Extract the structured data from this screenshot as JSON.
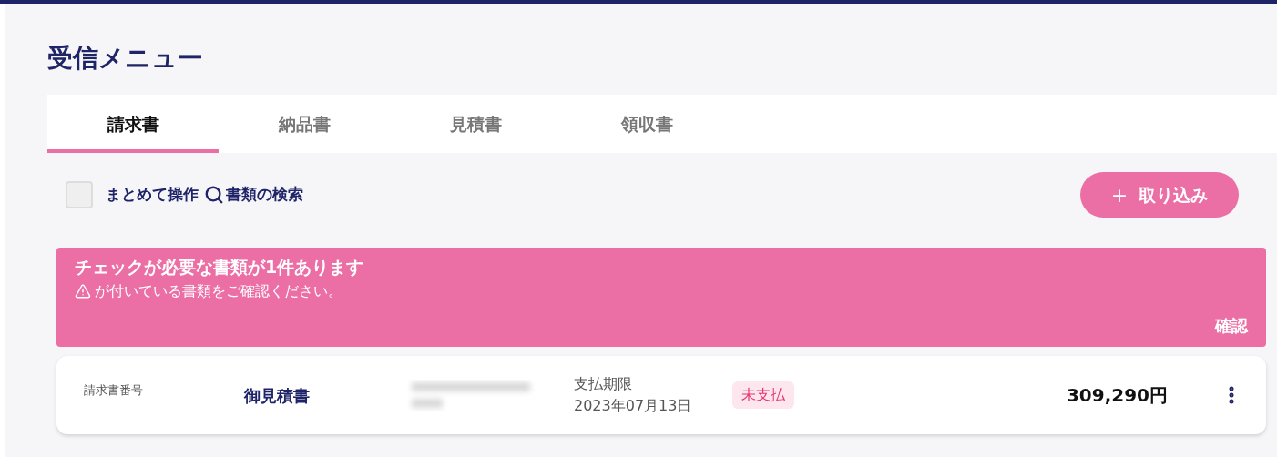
{
  "page_title": "受信メニュー",
  "tabs": [
    {
      "label": "請求書",
      "selected": true
    },
    {
      "label": "納品書",
      "selected": false
    },
    {
      "label": "見積書",
      "selected": false
    },
    {
      "label": "領収書",
      "selected": false
    }
  ],
  "toolbar": {
    "bulk_action": {
      "label": "まとめて操作",
      "checked": false
    },
    "search_link": "書類の検索",
    "import_button": {
      "icon": "+",
      "label": "取り込み"
    }
  },
  "alert": {
    "title": "チェックが必要な書類が1件あります",
    "message": "が付いている書類をご確認ください。",
    "action": "確認"
  },
  "documents": [
    {
      "number_label": "請求書番号",
      "title": "御見積書",
      "due_label": "支払期限",
      "due_date": "2023年07月13日",
      "status": "未支払",
      "amount": "309,290円"
    }
  ]
}
